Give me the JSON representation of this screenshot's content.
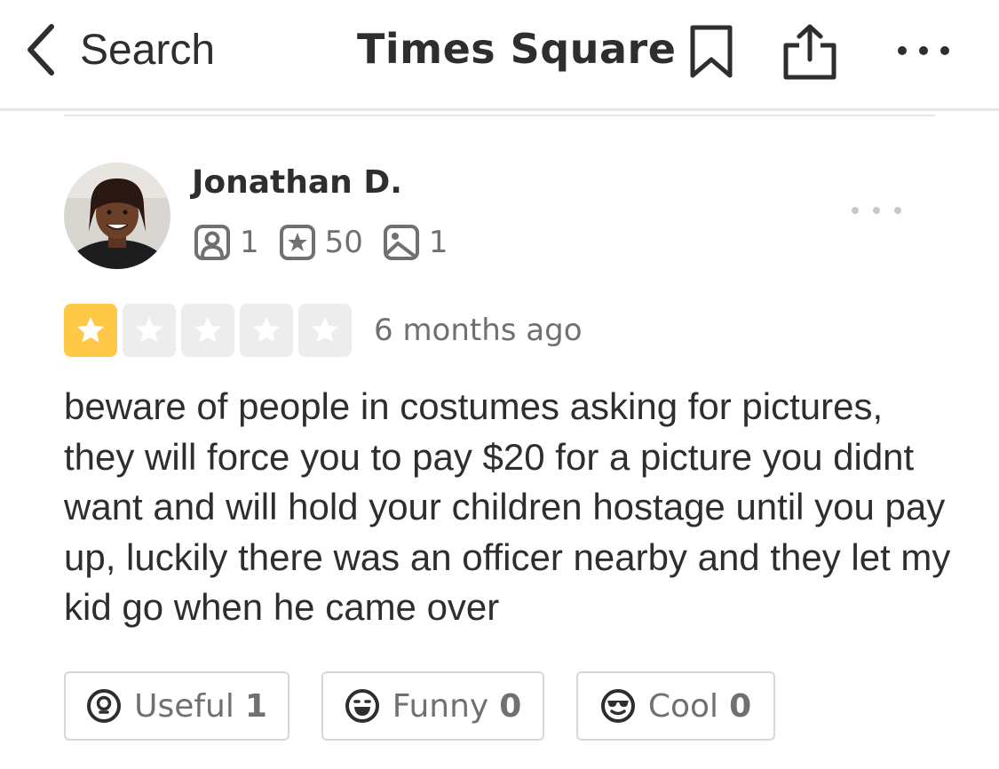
{
  "nav": {
    "back_label": "Search",
    "title": "Times Square"
  },
  "review": {
    "user": {
      "name": "Jonathan D.",
      "friends": "1",
      "reviews": "50",
      "photos": "1"
    },
    "rating": 1,
    "rating_max": 5,
    "date": "6 months ago",
    "text": "beware of people in costumes asking for pictures, they will force you to pay $20 for a picture you didnt want and will hold your children hostage until you pay up, luckily there was an officer nearby and they let my kid go when he came over",
    "reactions": [
      {
        "label": "Useful",
        "count": "1",
        "icon": "lightbulb-icon"
      },
      {
        "label": "Funny",
        "count": "0",
        "icon": "grin-icon"
      },
      {
        "label": "Cool",
        "count": "0",
        "icon": "sunglasses-icon"
      }
    ]
  },
  "colors": {
    "star_active": "#ffc947",
    "star_inactive": "#ededed",
    "text_primary": "#2d2e2f",
    "text_secondary": "#6e7072"
  }
}
